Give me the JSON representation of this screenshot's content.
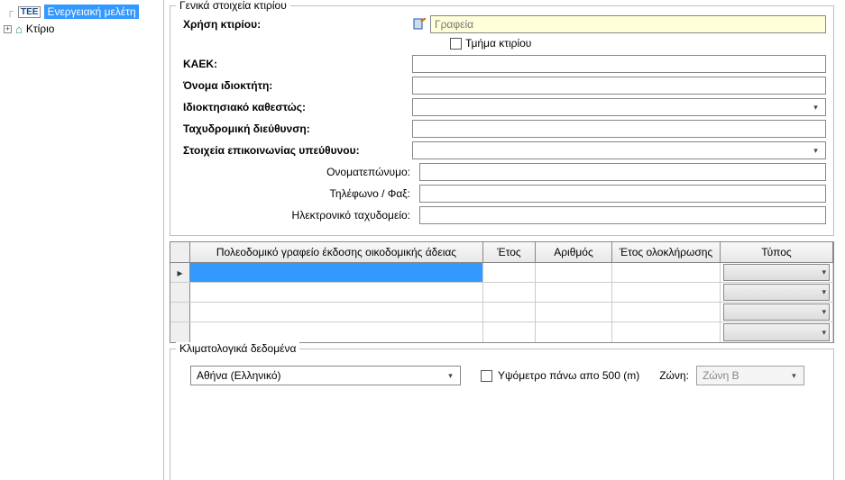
{
  "tree": {
    "root_label": "Ενεργειακή μελέτη",
    "child_label": "Κτίριο"
  },
  "general": {
    "legend": "Γενικά στοιχεία κτιρίου",
    "use_label": "Χρήση κτιρίου:",
    "use_value": "Γραφεία",
    "section_checkbox": "Τμήμα κτιρίου",
    "kaek_label": "ΚΑΕΚ:",
    "owner_label": "Όνομα ιδιοκτήτη:",
    "ownership_label": "Ιδιοκτησιακό καθεστώς:",
    "address_label": "Ταχυδρομική διεύθυνση:",
    "contact_label": "Στοιχεία επικοινωνίας υπεύθυνου:",
    "fullname_label": "Ονοματεπώνυμο:",
    "phonefax_label": "Τηλέφωνο / Φαξ:",
    "email_label": "Ηλεκτρονικό ταχυδομείο:"
  },
  "grid": {
    "col_pol": "Πολεοδομικό γραφείο έκδοσης οικοδομικής άδειας",
    "col_year": "Έτος",
    "col_num": "Αριθμός",
    "col_finish": "Έτος ολοκλήρωσης",
    "col_type": "Τύπος"
  },
  "climate": {
    "legend": "Κλιματολογικά δεδομένα",
    "city_value": "Αθήνα (Ελληνικό)",
    "alt_label": "Υψόμετρο πάνω απο 500 (m)",
    "zone_label": "Ζώνη:",
    "zone_value": "Ζώνη Β"
  }
}
